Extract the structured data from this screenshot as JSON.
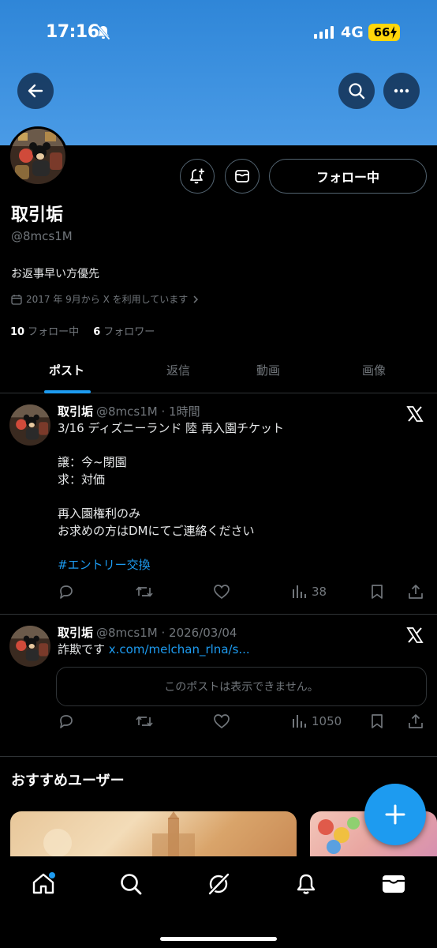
{
  "status_bar": {
    "time": "17:16",
    "network": "4G",
    "battery": "66"
  },
  "icons": {
    "back": "arrow-left-icon",
    "search": "search-icon",
    "more": "more-horizontal-icon",
    "notify": "bell-plus-icon",
    "message": "envelope-icon",
    "calendar": "calendar-icon"
  },
  "profile": {
    "display_name": "取引垢",
    "handle": "@8mcs1M",
    "bio": "お返事早い方優先",
    "joined": "2017 年 9月から X を利用しています",
    "following_count": "10",
    "following_label": "フォロー中",
    "followers_count": "6",
    "followers_label": "フォロワー",
    "follow_button": "フォロー中"
  },
  "tabs": [
    {
      "label": "ポスト",
      "active": true
    },
    {
      "label": "返信",
      "active": false
    },
    {
      "label": "動画",
      "active": false
    },
    {
      "label": "画像",
      "active": false
    }
  ],
  "posts": [
    {
      "name": "取引垢",
      "meta": "@8mcs1M · 1時間",
      "lines": [
        "3/16 ディズニーランド 陸 再入園チケット",
        "",
        "譲：今~閉園",
        "求：対価",
        "",
        "再入園権利のみ",
        "お求めの方はDMにてご連絡ください",
        ""
      ],
      "hashtag": "#エントリー交換",
      "views": "38"
    },
    {
      "name": "取引垢",
      "meta": "@8mcs1M · 2026/03/04",
      "text": "詐欺です ",
      "link": "x.com/melchan_rlna/s...",
      "unavailable": "このポストは表示できません。",
      "views": "1050"
    }
  ],
  "recommended": {
    "title": "おすすめユーザー"
  },
  "colors": {
    "accent": "#1d9bf0",
    "banner": "#4a9be6",
    "muted": "#71767b",
    "border": "#2f3336"
  }
}
